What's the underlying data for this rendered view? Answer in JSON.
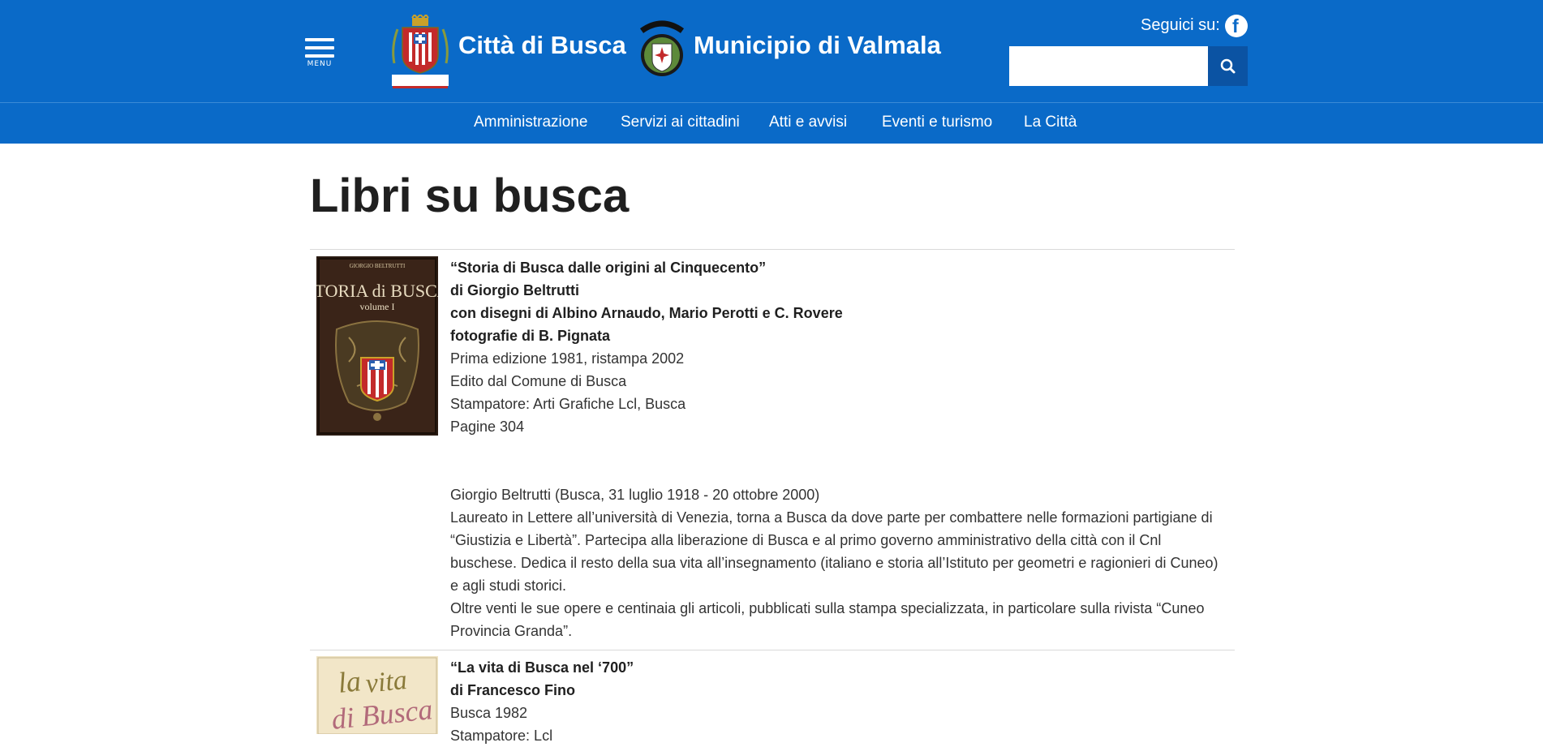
{
  "header": {
    "menu_label": "MENU",
    "brand_primary": "Città di Busca",
    "brand_secondary": "Municipio di Valmala",
    "follow_label": "Seguici su:",
    "search": {
      "value": "",
      "placeholder": ""
    },
    "colors": {
      "header_bg": "#0a6ac8",
      "search_button_bg": "#0b53a3"
    }
  },
  "nav": {
    "items": [
      "Amministrazione",
      "Servizi ai cittadini",
      "Atti e avvisi",
      "Eventi e turismo",
      "La Città"
    ]
  },
  "main": {
    "title": "Libri su busca",
    "books": [
      {
        "cover_icon": "book-cover-storia-di-busca",
        "lines": [
          "“Storia di Busca dalle origini al Cinquecento”",
          "di Giorgio Beltrutti",
          "con disegni di Albino Arnaudo, Mario Perotti e C. Rovere",
          "fotografie di B. Pignata",
          "Prima edizione 1981, ristampa 2002",
          "Edito dal Comune di Busca",
          "Stampatore: Arti Grafiche Lcl, Busca",
          "Pagine 304"
        ],
        "bio": [
          "Giorgio Beltrutti (Busca, 31 luglio 1918 - 20 ottobre 2000)",
          "Laureato in Lettere all’università di Venezia, torna a Busca da dove parte per combattere nelle formazioni partigiane di “Giustizia e Libertà”. Partecipa alla liberazione di Busca e al primo governo amministrativo della città con il Cnl buschese. Dedica il resto della sua vita all’insegnamento (italiano e storia all’Istituto per geometri e ragionieri di Cuneo) e agli studi storici.",
          "Oltre venti le sue opere e centinaia gli articoli, pubblicati sulla stampa specializzata, in particolare sulla rivista “Cuneo Provincia Granda”."
        ]
      },
      {
        "cover_icon": "book-cover-la-vita-di-busca",
        "lines": [
          "“La vita di Busca nel ‘700”",
          "di Francesco Fino",
          "Busca 1982",
          "Stampatore: Lcl"
        ]
      }
    ]
  }
}
